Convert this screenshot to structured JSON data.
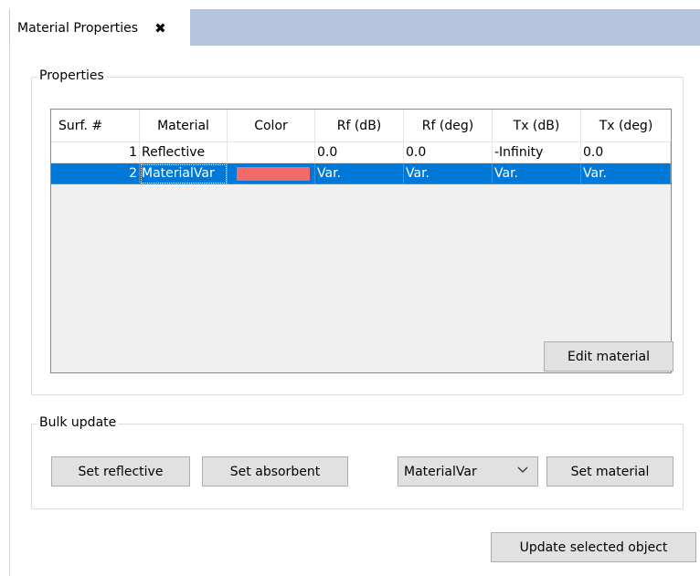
{
  "tab": {
    "title": "Material Properties",
    "close_glyph": "✖"
  },
  "properties": {
    "group_title": "Properties",
    "columns": [
      "Surf. #",
      "Material",
      "Color",
      "Rf (dB)",
      "Rf (deg)",
      "Tx (dB)",
      "Tx (deg)"
    ],
    "rows": [
      {
        "surf": "1",
        "material": "Reflective",
        "color": "",
        "rf_db": "0.0",
        "rf_deg": "0.0",
        "tx_db": "-Infinity",
        "tx_deg": "0.0",
        "selected": false
      },
      {
        "surf": "2",
        "material": "MaterialVar",
        "color": "#f26b6b",
        "rf_db": "Var.",
        "rf_deg": "Var.",
        "tx_db": "Var.",
        "tx_deg": "Var.",
        "selected": true
      }
    ],
    "edit_button": "Edit material"
  },
  "bulk": {
    "group_title": "Bulk update",
    "set_reflective": "Set reflective",
    "set_absorbent": "Set absorbent",
    "material_select": "MaterialVar",
    "set_material": "Set material"
  },
  "update_button": "Update selected object",
  "colors": {
    "selection": "#0078d7",
    "tabbar": "#b4c5dd",
    "button": "#e1e1e1"
  }
}
